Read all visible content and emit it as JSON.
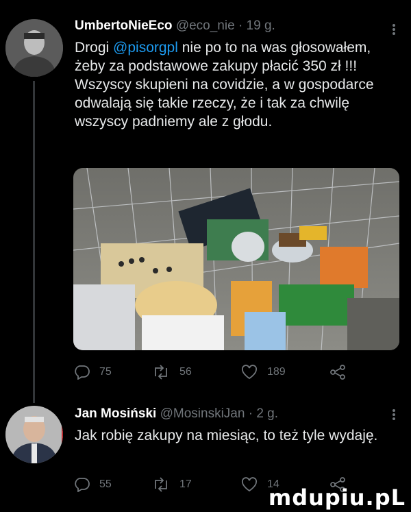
{
  "tweets": [
    {
      "display_name": "UmbertoNieEco",
      "handle": "@eco_nie",
      "sep": "·",
      "time": "19 g.",
      "text_prefix": "Drogi ",
      "mention": "@pisorgpl",
      "text_rest": " nie po to na was głosowałem, żeby za podstawowe zakupy płacić 350 zł !!! Wszyscy skupieni na covidzie, a w gospodarce odwalają się takie rzeczy, że i tak za chwilę wszyscy padniemy ale z głodu.",
      "replies": "75",
      "retweets": "56",
      "likes": "189"
    },
    {
      "display_name": "Jan Mosiński",
      "handle": "@MosinskiJan",
      "sep": "·",
      "time": "2 g.",
      "text": "Jak robię zakupy na miesiąc, to też tyle wydaję.",
      "replies": "55",
      "retweets": "17",
      "likes": "14"
    }
  ],
  "watermark": "mdupiu.pL",
  "colors": {
    "background": "#000000",
    "text": "#e7e9ea",
    "muted": "#71767b",
    "link": "#1d9bf0"
  }
}
